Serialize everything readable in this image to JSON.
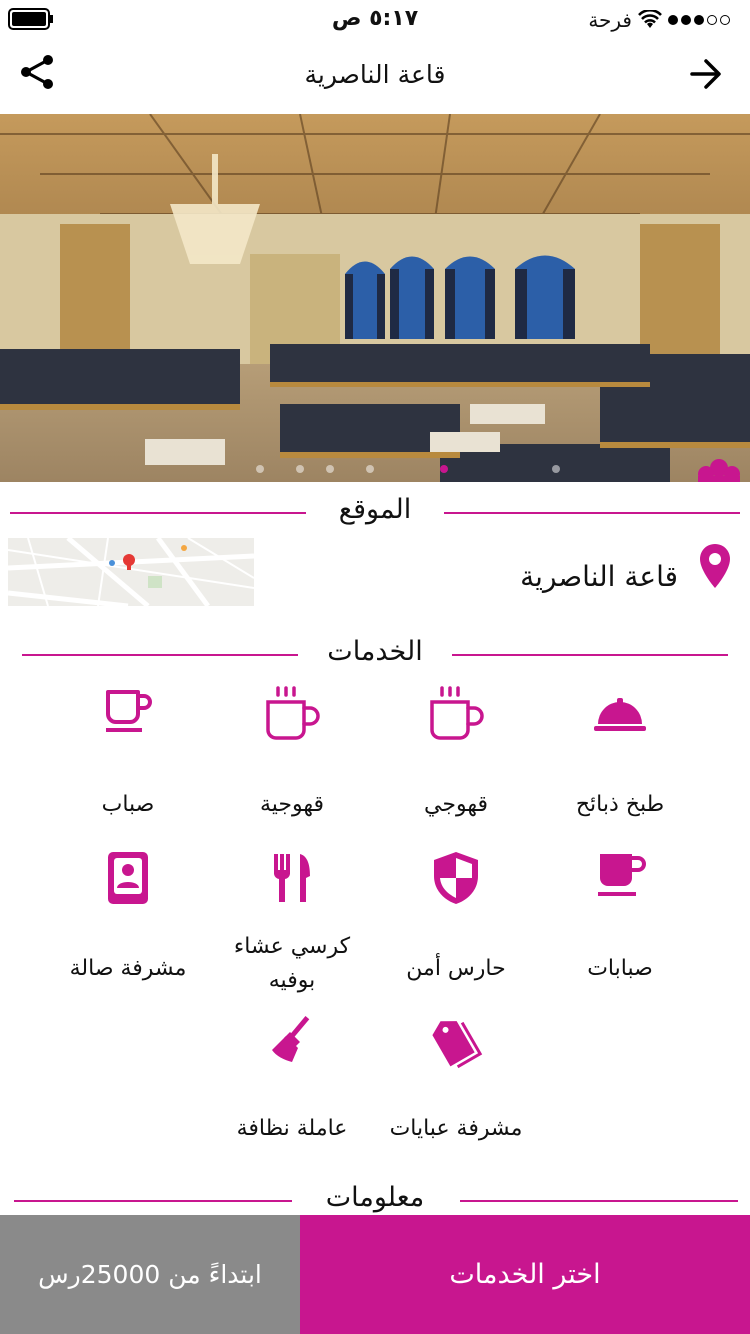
{
  "status_bar": {
    "time": "٥:١٧ ص",
    "carrier": "فرحة"
  },
  "header": {
    "title": "قاعة الناصرية",
    "share_icon": "share-icon",
    "back_icon": "arrow-right-icon"
  },
  "carousel": {
    "image_alt": "hall interior photo",
    "slide_count": 6,
    "active_index": 4
  },
  "location": {
    "section_title": "الموقع",
    "name": "قاعة الناصرية",
    "pin_icon": "location-pin-icon",
    "map_label": "map thumbnail"
  },
  "services": {
    "section_title": "الخدمات",
    "items": [
      {
        "label": "طبخ ذبائح",
        "icon": "cloche-icon"
      },
      {
        "label": "قهوجي",
        "icon": "hot-cup-icon"
      },
      {
        "label": "قهوجية",
        "icon": "hot-cup-icon"
      },
      {
        "label": "صباب",
        "icon": "cup-icon"
      },
      {
        "label": "صبابات",
        "icon": "cup-icon"
      },
      {
        "label": "حارس أمن",
        "icon": "shield-icon"
      },
      {
        "label": "كرسي عشاء بوفيه",
        "icon": "cutlery-icon"
      },
      {
        "label": "مشرفة صالة",
        "icon": "contact-card-icon"
      },
      {
        "label": "مشرفة عبايات",
        "icon": "tags-icon"
      },
      {
        "label": "عاملة نظافة",
        "icon": "broom-icon"
      }
    ]
  },
  "info": {
    "section_title": "معلومات"
  },
  "bottom_bar": {
    "price_label": "ابتداءً من 25000رس",
    "choose_label": "اختر الخدمات"
  },
  "colors": {
    "accent": "#c8168f",
    "price_bg": "#8a8a8a"
  }
}
